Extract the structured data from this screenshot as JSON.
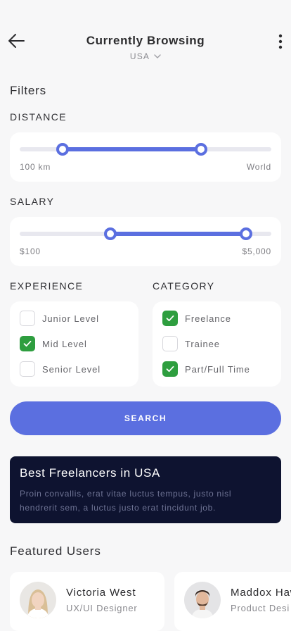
{
  "header": {
    "title": "Currently Browsing",
    "location": "USA"
  },
  "filters": {
    "title": "Filters",
    "distance": {
      "label": "DISTANCE",
      "min_label": "100 km",
      "max_label": "World",
      "range_start": 0.17,
      "range_end": 0.72
    },
    "salary": {
      "label": "SALARY",
      "min_label": "$100",
      "max_label": "$5,000",
      "range_start": 0.36,
      "range_end": 0.9
    },
    "experience": {
      "label": "EXPERIENCE",
      "options": [
        {
          "label": "Junior Level",
          "checked": false
        },
        {
          "label": "Mid Level",
          "checked": true
        },
        {
          "label": "Senior Level",
          "checked": false
        }
      ]
    },
    "category": {
      "label": "CATEGORY",
      "options": [
        {
          "label": "Freelance",
          "checked": true
        },
        {
          "label": "Trainee",
          "checked": false
        },
        {
          "label": "Part/Full Time",
          "checked": true
        }
      ]
    },
    "search_label": "SEARCH"
  },
  "promo": {
    "title": "Best Freelancers in USA",
    "text": "Proin convallis, erat vitae luctus tempus, justo nisl hendrerit sem, a luctus justo erat tincidunt job."
  },
  "featured": {
    "title": "Featured Users",
    "users": [
      {
        "name": "Victoria West",
        "role": "UX/UI Designer"
      },
      {
        "name": "Maddox Haw",
        "role": "Product Desi"
      }
    ]
  },
  "colors": {
    "accent": "#5b6fe0",
    "check": "#2e9e3f",
    "promo_bg": "#0e1330"
  }
}
